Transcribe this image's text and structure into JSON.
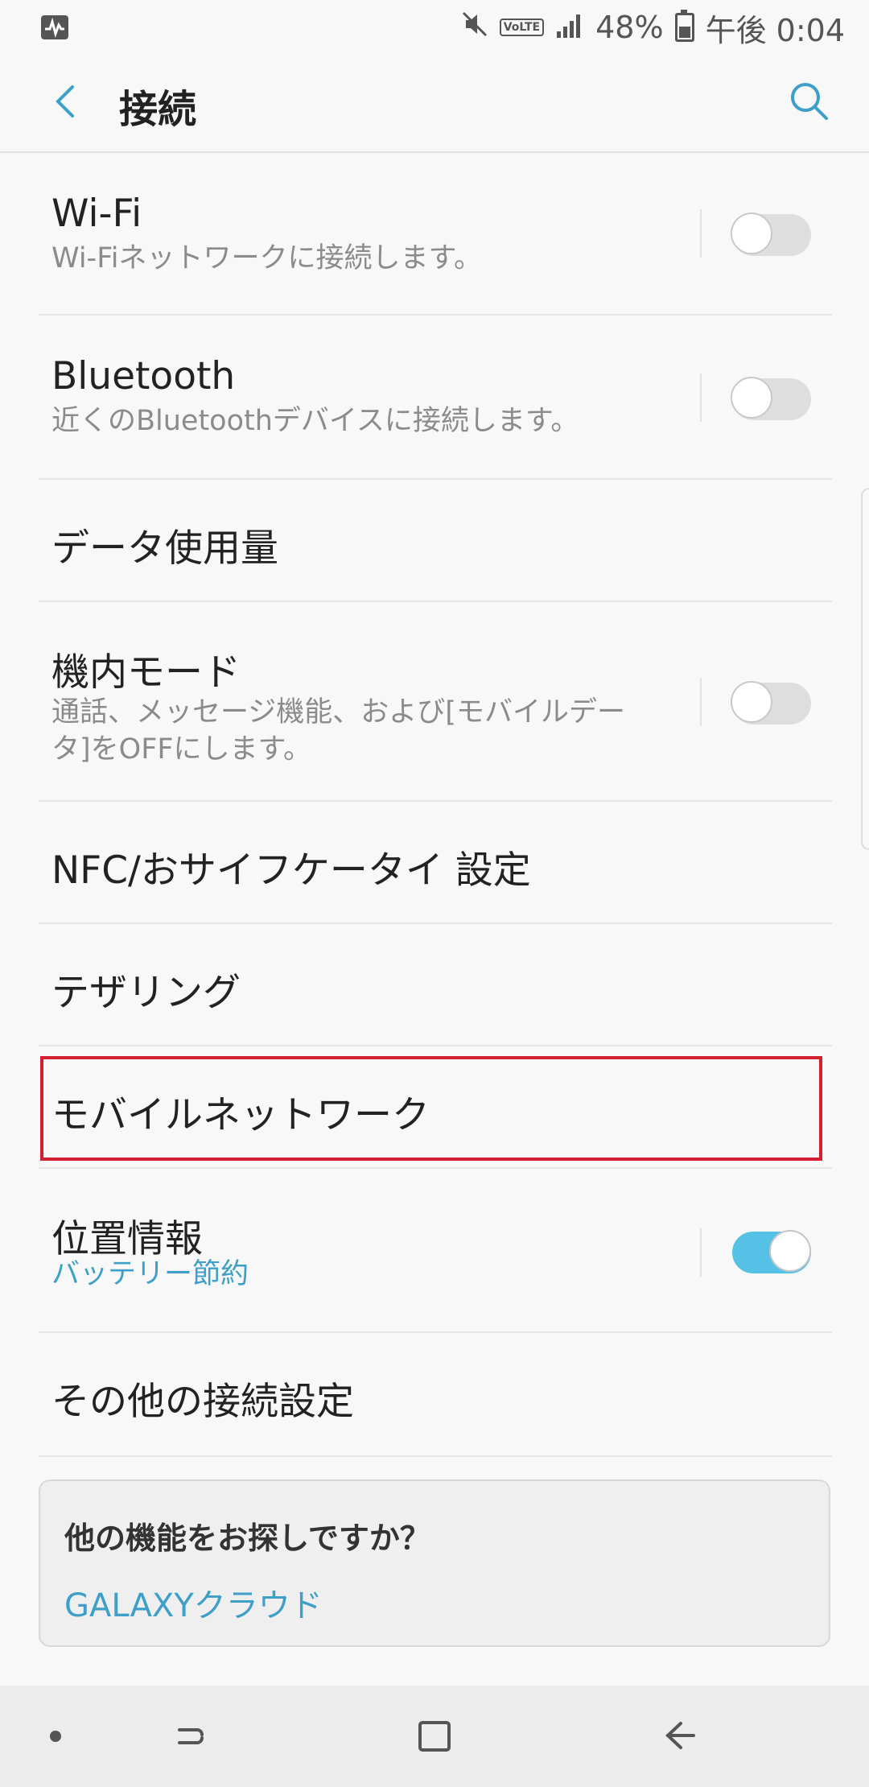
{
  "status_bar": {
    "battery_percent": "48%",
    "time": "午後 0:04",
    "volte_label": "VoLTE",
    "battery_level": 0.48
  },
  "app_bar": {
    "title": "接続"
  },
  "items": [
    {
      "label": "Wi-Fi",
      "sub": "Wi-Fiネットワークに接続します。",
      "toggle": false
    },
    {
      "label": "Bluetooth",
      "sub": "近くのBluetoothデバイスに接続します。",
      "toggle": false
    },
    {
      "label": "データ使用量"
    },
    {
      "label": "機内モード",
      "sub_line1": "通話、メッセージ機能、および[モバイルデー",
      "sub_line2": "タ]をOFFにします。",
      "toggle": false
    },
    {
      "label": "NFC/おサイフケータイ 設定"
    },
    {
      "label": "テザリング"
    },
    {
      "label": "モバイルネットワーク",
      "highlighted": true
    },
    {
      "label": "位置情報",
      "sub": "バッテリー節約",
      "toggle": true
    },
    {
      "label": "その他の接続設定"
    }
  ],
  "suggestion_card": {
    "question": "他の機能をお探しですか？",
    "link": "GALAXYクラウド"
  },
  "colors": {
    "accent": "#3e9fc9",
    "toggle_on": "#55c1e7",
    "highlight_border": "#d32030"
  }
}
